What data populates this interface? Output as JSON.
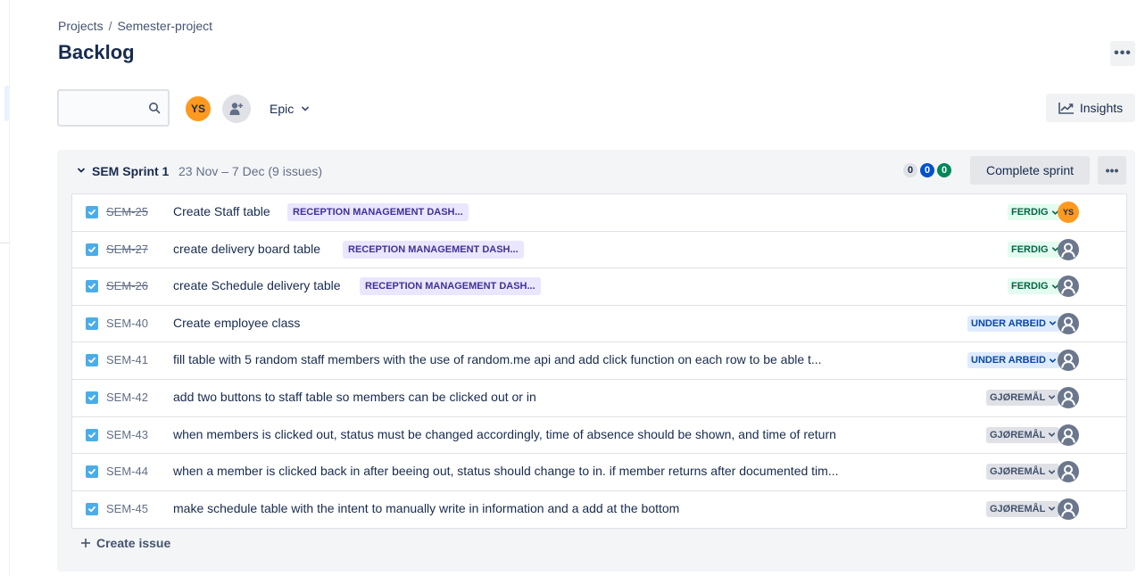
{
  "breadcrumb": {
    "projects": "Projects",
    "separator": "/",
    "project": "Semester-project"
  },
  "page": {
    "title": "Backlog",
    "more_label": "•••"
  },
  "toolbar": {
    "search_placeholder": "",
    "search_icon": "search-icon",
    "avatar_initials": "YS",
    "add_people_icon": "add-people-icon",
    "epic_label": "Epic",
    "insights_label": "Insights"
  },
  "sprint": {
    "name": "SEM Sprint 1",
    "dates": "23 Nov – 7 Dec",
    "issue_count": "(9 issues)",
    "counts": {
      "todo": "0",
      "in_progress": "0",
      "done": "0"
    },
    "complete_label": "Complete sprint",
    "more_label": "•••",
    "create_issue_label": "Create issue"
  },
  "issues": [
    {
      "key": "SEM-25",
      "done": true,
      "summary": "Create Staff table",
      "epic": "RECEPTION MANAGEMENT DASH...",
      "status": "FERDIG",
      "status_type": "done",
      "assignee": "YS"
    },
    {
      "key": "SEM-27",
      "done": true,
      "summary": "create delivery board table",
      "epic": "RECEPTION MANAGEMENT DASH...",
      "status": "FERDIG",
      "status_type": "done",
      "assignee": ""
    },
    {
      "key": "SEM-26",
      "done": true,
      "summary": "create Schedule delivery table",
      "epic": "RECEPTION MANAGEMENT DASH...",
      "status": "FERDIG",
      "status_type": "done",
      "assignee": ""
    },
    {
      "key": "SEM-40",
      "done": false,
      "summary": "Create employee class",
      "epic": "",
      "status": "UNDER ARBEID",
      "status_type": "progress",
      "assignee": ""
    },
    {
      "key": "SEM-41",
      "done": false,
      "summary": "fill table with 5 random staff members with the use of random.me api and add click function on each row to be able t...",
      "epic": "",
      "status": "UNDER ARBEID",
      "status_type": "progress",
      "assignee": ""
    },
    {
      "key": "SEM-42",
      "done": false,
      "summary": "add two buttons to staff table so members can be clicked out or in",
      "epic": "",
      "status": "GJØREMÅL",
      "status_type": "todo",
      "assignee": ""
    },
    {
      "key": "SEM-43",
      "done": false,
      "summary": "when members is clicked out, status must be changed accordingly, time of absence should be shown, and time of return",
      "epic": "",
      "status": "GJØREMÅL",
      "status_type": "todo",
      "assignee": ""
    },
    {
      "key": "SEM-44",
      "done": false,
      "summary": "when a member is clicked back in after beeing out, status should change to in. if member returns after documented tim...",
      "epic": "",
      "status": "GJØREMÅL",
      "status_type": "todo",
      "assignee": ""
    },
    {
      "key": "SEM-45",
      "done": false,
      "summary": "make schedule table with the intent to manually write in information and a add at the bottom",
      "epic": "",
      "status": "GJØREMÅL",
      "status_type": "todo",
      "assignee": ""
    }
  ],
  "colors": {
    "brand_blue": "#0052cc",
    "done_green": "#00875a",
    "epic_purple": "#403294",
    "avatar_orange": "#ff991f",
    "task_icon_blue": "#4bade8"
  }
}
